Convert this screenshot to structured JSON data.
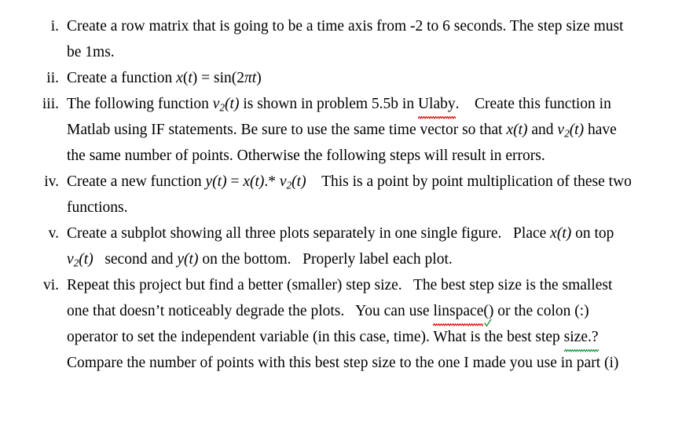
{
  "document": {
    "type": "numbered-instruction-list",
    "background_color": "#ffffff",
    "text_color": "#000000",
    "spellcheck_color": "#e00000",
    "grammarcheck_color": "#159030",
    "items": [
      {
        "marker": "i.",
        "segments": [
          {
            "kind": "text",
            "value": "Create a row matrix that is going to be a time axis from -2 to 6 seconds. The step size must be 1ms."
          }
        ],
        "plain_text": "Create a row matrix that is going to be a time axis from -2 to 6 seconds. The step size must be 1ms."
      },
      {
        "marker": "ii.",
        "segments": [
          {
            "kind": "text",
            "value": "Create a function "
          },
          {
            "kind": "math",
            "value": "x(t) = sin(2πt)"
          }
        ],
        "plain_text": "Create a function x(t) = sin(2πt)"
      },
      {
        "marker": "iii.",
        "segments": [
          {
            "kind": "text",
            "value": "The following function "
          },
          {
            "kind": "math",
            "value": "v₂(t)"
          },
          {
            "kind": "text",
            "value": " is shown in problem 5.5b in "
          },
          {
            "kind": "misspelled",
            "value": "Ulaby"
          },
          {
            "kind": "text",
            "value": ".  Create this function in Matlab using IF statements. Be sure to use the same time vector so that "
          },
          {
            "kind": "math",
            "value": "x(t)"
          },
          {
            "kind": "text",
            "value": " and "
          },
          {
            "kind": "math",
            "value": "v₂(t)"
          },
          {
            "kind": "text",
            "value": " have the same number of points. Otherwise the following steps will result in errors."
          }
        ],
        "plain_text": "The following function v₂(t) is shown in problem 5.5b in Ulaby.  Create this function in Matlab using IF statements. Be sure to use the same time vector so that x(t) and v₂(t) have the same number of points. Otherwise the following steps will result in errors."
      },
      {
        "marker": "iv.",
        "segments": [
          {
            "kind": "text",
            "value": "Create a new function "
          },
          {
            "kind": "math",
            "value": "y(t) = x(t).* v₂(t)"
          },
          {
            "kind": "text",
            "value": "  This is a point by point multiplication of these two functions."
          }
        ],
        "plain_text": "Create a new function y(t) = x(t).* v₂(t)  This is a point by point multiplication of these two functions."
      },
      {
        "marker": "v.",
        "segments": [
          {
            "kind": "text",
            "value": "Create a subplot showing all three plots separately in one single figure.  Place "
          },
          {
            "kind": "math",
            "value": "x(t)"
          },
          {
            "kind": "text",
            "value": " on top "
          },
          {
            "kind": "math",
            "value": "v₂(t)"
          },
          {
            "kind": "text",
            "value": "  second and "
          },
          {
            "kind": "math",
            "value": "y(t)"
          },
          {
            "kind": "text",
            "value": " on the bottom.  Properly label each plot."
          }
        ],
        "plain_text": "Create a subplot showing all three plots separately in one single figure.  Place x(t) on top v₂(t)  second and y(t) on the bottom.  Properly label each plot."
      },
      {
        "marker": "vi.",
        "segments": [
          {
            "kind": "text",
            "value": "Repeat this project but find a better (smaller) step size.  The best step size is the smallest one that doesn’t noticeably degrade the plots.  You can use "
          },
          {
            "kind": "misspelled",
            "value": "linspace"
          },
          {
            "kind": "grammar-tick",
            "value": "()"
          },
          {
            "kind": "text",
            "value": " or the colon (:) operator to set the independent variable (in this case, time). What is the best step "
          },
          {
            "kind": "grammar",
            "value": "size.?"
          },
          {
            "kind": "text",
            "value": " Compare the number of points with this best step size to the one I made you use in part (i)"
          }
        ],
        "plain_text": "Repeat this project but find a better (smaller) step size.  The best step size is the smallest one that doesn’t noticeably degrade the plots.  You can use linspace() or the colon (:) operator to set the independent variable (in this case, time). What is the best step size.? Compare the number of points with this best step size to the one I made you use in part (i)"
      }
    ]
  },
  "i": {
    "marker": "i.",
    "t1": "Create a row matrix that is going to be a time axis from -2 to 6 seconds. The step size must be 1ms."
  },
  "ii": {
    "marker": "ii.",
    "t1": "Create a function ",
    "m1_x": "x",
    "m1_open": "(",
    "m1_t": "t",
    "m1_close": ")",
    "m1_eq": " = ",
    "m1_sin": "sin(2",
    "m1_pi": "π",
    "m1_t2": "t",
    "m1_end": ")"
  },
  "iii": {
    "marker": "iii.",
    "t1": "The following function ",
    "m1_v": "v",
    "m1_sub": "2",
    "m1_t": "(t)",
    "t2": " is shown in problem 5.5b in ",
    "misspell": "Ulaby",
    "t3": ". Create this function in Matlab using IF statements. Be sure to use the same time vector so that ",
    "m2": "x(t)",
    "t4": " and ",
    "m3_v": "v",
    "m3_sub": "2",
    "m3_t": "(t)",
    "t5": " have the same number of points. Otherwise the following steps will result in errors."
  },
  "iv": {
    "marker": "iv.",
    "t1": "Create a new function ",
    "m1_y": "y",
    "m1_yt": "(t)",
    "m1_eq": " = ",
    "m1_x": "x",
    "m1_xt": "(t)",
    "m1_dotstar": ".*",
    "m1_v": "v",
    "m1_sub": "2",
    "m1_vt": "(t)",
    "t2": " This is a point by point multiplication of these two functions."
  },
  "v": {
    "marker": "v.",
    "t1": "Create a subplot showing all three plots separately in one single figure.  Place ",
    "m1": "x(t)",
    "t2": " on top ",
    "m2_v": "v",
    "m2_sub": "2",
    "m2_t": "(t)",
    "t3": "  second and ",
    "m3": "y(t)",
    "t4": " on the bottom.  Properly label each plot."
  },
  "vi": {
    "marker": "vi.",
    "t1": "Repeat this project but find a better (smaller) step size.  The best step size is the smallest one that doesn’t noticeably degrade the plots.  You can use ",
    "misspell": "linspace",
    "parens": "()",
    "t2": " or the colon (:) operator to set the independent variable (in this case, time). What is the best step ",
    "grammar": "size.?",
    "t3": " Compare the number of points with this best step size to the one I made you use in part (i)"
  }
}
